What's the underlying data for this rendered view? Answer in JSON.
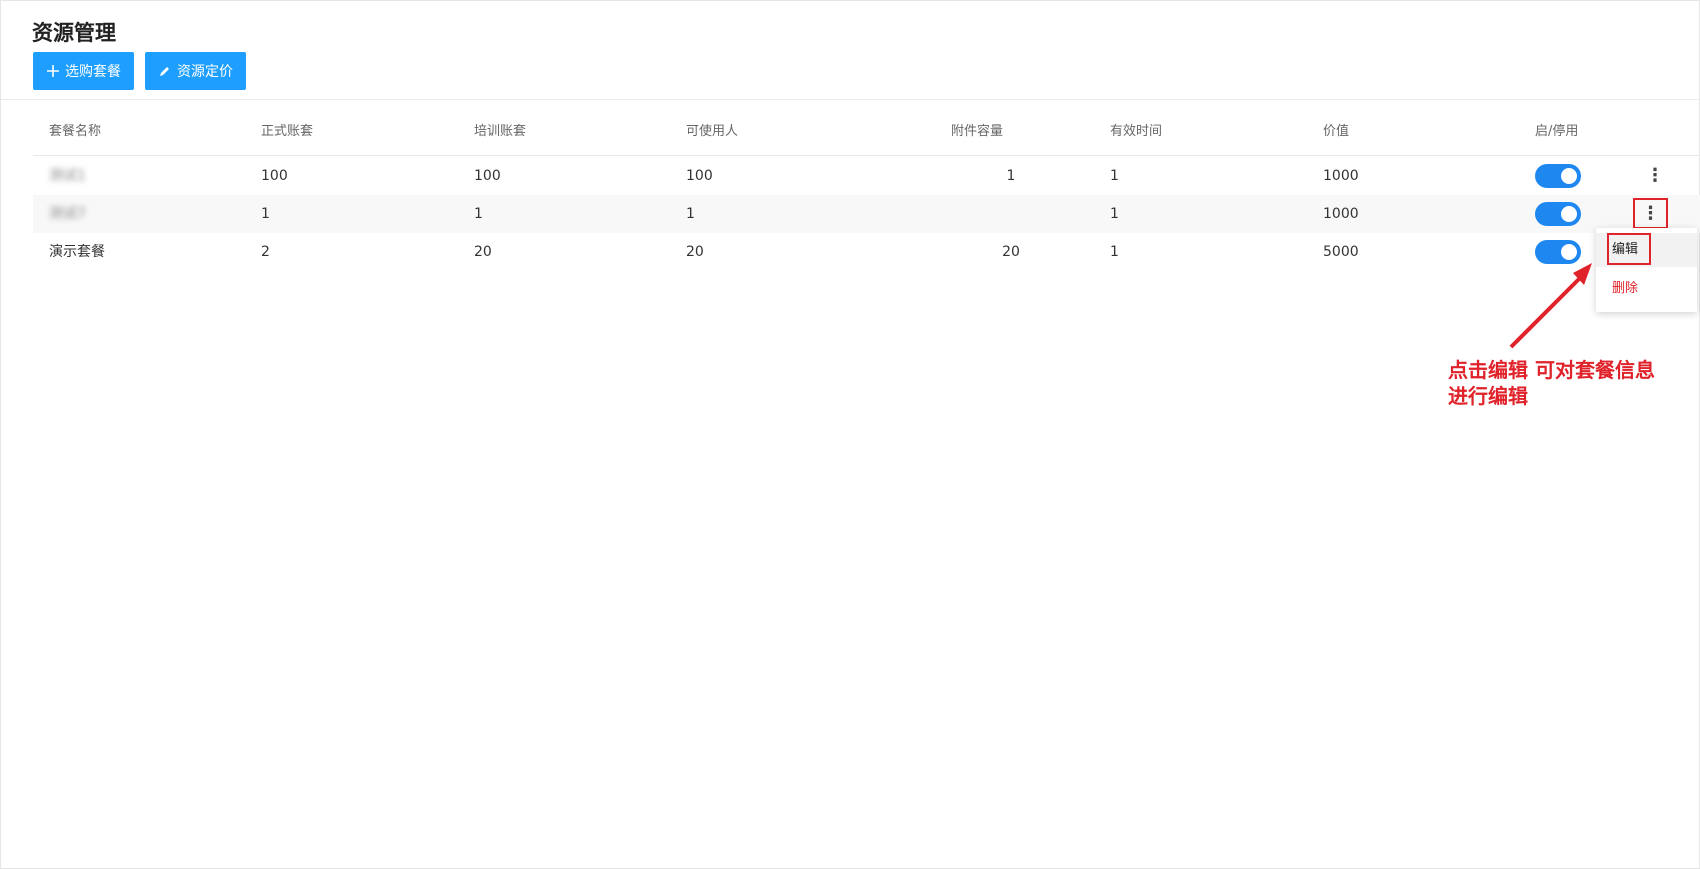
{
  "page": {
    "title": "资源管理"
  },
  "toolbar": {
    "buy_label": "选购套餐",
    "price_label": "资源定价"
  },
  "table": {
    "headers": [
      "套餐名称",
      "正式账套",
      "培训账套",
      "可使用人",
      "附件容量",
      "有效时间",
      "价值",
      "启/停用"
    ],
    "rows": [
      {
        "name": "测试1",
        "formal": "100",
        "training": "100",
        "users": "100",
        "storage": "1",
        "valid": "1",
        "value": "1000",
        "enabled": true
      },
      {
        "name": "测试7",
        "formal": "1",
        "training": "1",
        "users": "1",
        "storage": "",
        "valid": "1",
        "value": "1000",
        "enabled": true
      },
      {
        "name": "演示套餐",
        "formal": "2",
        "training": "20",
        "users": "20",
        "storage": "20",
        "valid": "1",
        "value": "5000",
        "enabled": true
      }
    ]
  },
  "dropdown": {
    "edit_label": "编辑",
    "delete_label": "删除"
  },
  "annotation": {
    "line1": "点击编辑  可对套餐信息",
    "line2": "进行编辑"
  },
  "colors": {
    "primary": "#1e9fff",
    "switch_on": "#1e87f0",
    "annotation": "#e0222a"
  },
  "icons": {
    "buy": "plus-icon",
    "price": "pencil-icon",
    "more": "more-vertical-icon"
  }
}
